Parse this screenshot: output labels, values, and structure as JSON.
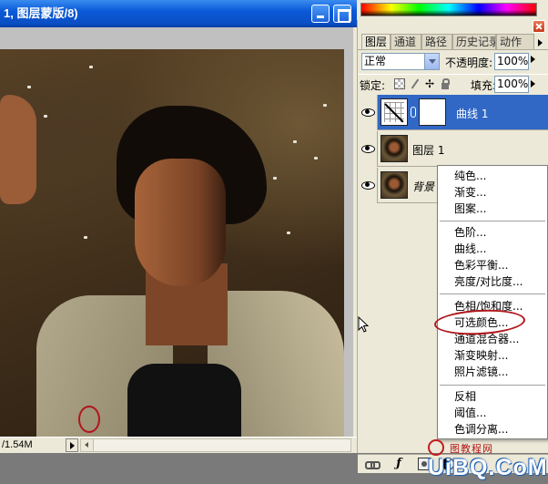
{
  "doc_window": {
    "title": "1, 图层蒙版/8)",
    "status_size": "/1.54M"
  },
  "color_panel": {},
  "layers_panel": {
    "tabs": [
      "图层",
      "通道",
      "路径",
      "历史记录",
      "动作"
    ],
    "blend_mode": "正常",
    "opacity_label": "不透明度:",
    "opacity_value": "100%",
    "lock_label": "锁定:",
    "fill_label": "填充:",
    "fill_value": "100%",
    "layers": [
      {
        "name": "曲线 1",
        "selected": true
      },
      {
        "name": "图层 1",
        "selected": false
      },
      {
        "name": "背景",
        "selected": false
      }
    ]
  },
  "adjust_menu": {
    "groups": [
      [
        "纯色...",
        "渐变...",
        "图案..."
      ],
      [
        "色阶...",
        "曲线...",
        "色彩平衡...",
        "亮度/对比度..."
      ],
      [
        "色相/饱和度...",
        "可选颜色...",
        "通道混合器...",
        "渐变映射...",
        "照片滤镜..."
      ],
      [
        "反相",
        "阈值...",
        "色调分离..."
      ]
    ],
    "highlighted": "可选颜色..."
  },
  "watermark": {
    "logo": "UiBQ.CoM",
    "subtitle": "图教程网"
  },
  "colors": {
    "titlebar": "#0a4fc4",
    "selection": "#3168c5",
    "annotation_red": "#b0161b"
  }
}
